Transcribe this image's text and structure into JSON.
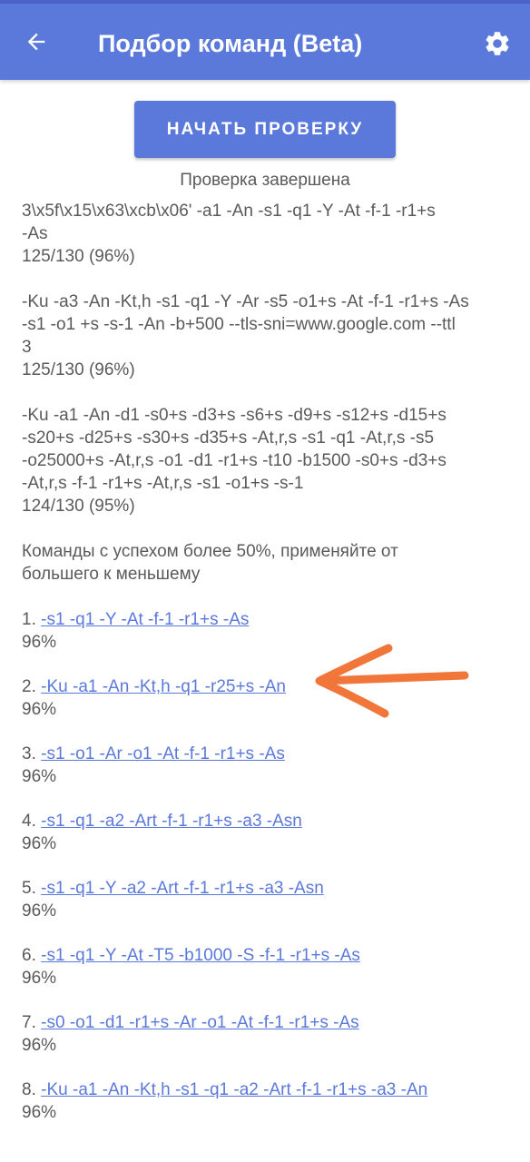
{
  "appbar": {
    "title": "Подбор команд (Beta)",
    "back_icon": "arrow-left-icon",
    "settings_icon": "gear-icon",
    "background": "#5b79db"
  },
  "start_button": {
    "label": "НАЧАТЬ ПРОВЕРКУ"
  },
  "status": "Проверка завершена",
  "results": [
    {
      "lines": [
        "3\\x5f\\x15\\x63\\xcb\\x06' -a1 -An -s1 -q1 -Y -At -f-1 -r1+s",
        "-As"
      ],
      "score": "125/130 (96%)"
    },
    {
      "lines": [
        "-Ku -a3 -An -Kt,h -s1 -q1 -Y -Ar -s5 -o1+s -At -f-1 -r1+s -As",
        "-s1 -o1 +s -s-1 -An -b+500 --tls-sni=www.google.com --ttl",
        "3"
      ],
      "score": "125/130 (96%)"
    },
    {
      "lines": [
        "-Ku -a1 -An -d1 -s0+s -d3+s -s6+s -d9+s -s12+s -d15+s",
        "-s20+s -d25+s -s30+s -d35+s -At,r,s -s1 -q1 -At,r,s -s5",
        "-o25000+s -At,r,s -o1 -d1 -r1+s -t10 -b1500 -s0+s -d3+s",
        "-At,r,s -f-1 -r1+s -At,r,s -s1 -o1+s -s-1"
      ],
      "score": "124/130 (95%)"
    }
  ],
  "summary_lines": [
    "Команды с успехом более 50%, применяйте от",
    "большего к меньшему"
  ],
  "commands": [
    {
      "num": "1.",
      "cmd": "-s1 -q1 -Y -At -f-1 -r1+s -As",
      "pct": "96%"
    },
    {
      "num": "2.",
      "cmd": "-Ku -a1 -An -Kt,h -q1 -r25+s -An",
      "pct": "96%"
    },
    {
      "num": "3.",
      "cmd": "-s1 -o1 -Ar -o1 -At -f-1 -r1+s -As",
      "pct": "96%"
    },
    {
      "num": "4.",
      "cmd": "-s1 -q1 -a2 -Art -f-1 -r1+s -a3 -Asn",
      "pct": "96%"
    },
    {
      "num": "5.",
      "cmd": "-s1 -q1 -Y -a2 -Art -f-1 -r1+s -a3 -Asn",
      "pct": "96%"
    },
    {
      "num": "6.",
      "cmd": "-s1 -q1 -Y -At -T5 -b1000 -S -f-1 -r1+s -As",
      "pct": "96%"
    },
    {
      "num": "7.",
      "cmd": "-s0 -o1 -d1 -r1+s -Ar -o1 -At -f-1 -r1+s -As",
      "pct": "96%"
    },
    {
      "num": "8.",
      "cmd": "-Ku -a1 -An -Kt,h -s1 -q1 -a2 -Art -f-1 -r1+s -a3 -An",
      "pct": "96%"
    }
  ],
  "annotation": {
    "icon": "arrow-annotation-icon",
    "color": "#f0763a"
  }
}
